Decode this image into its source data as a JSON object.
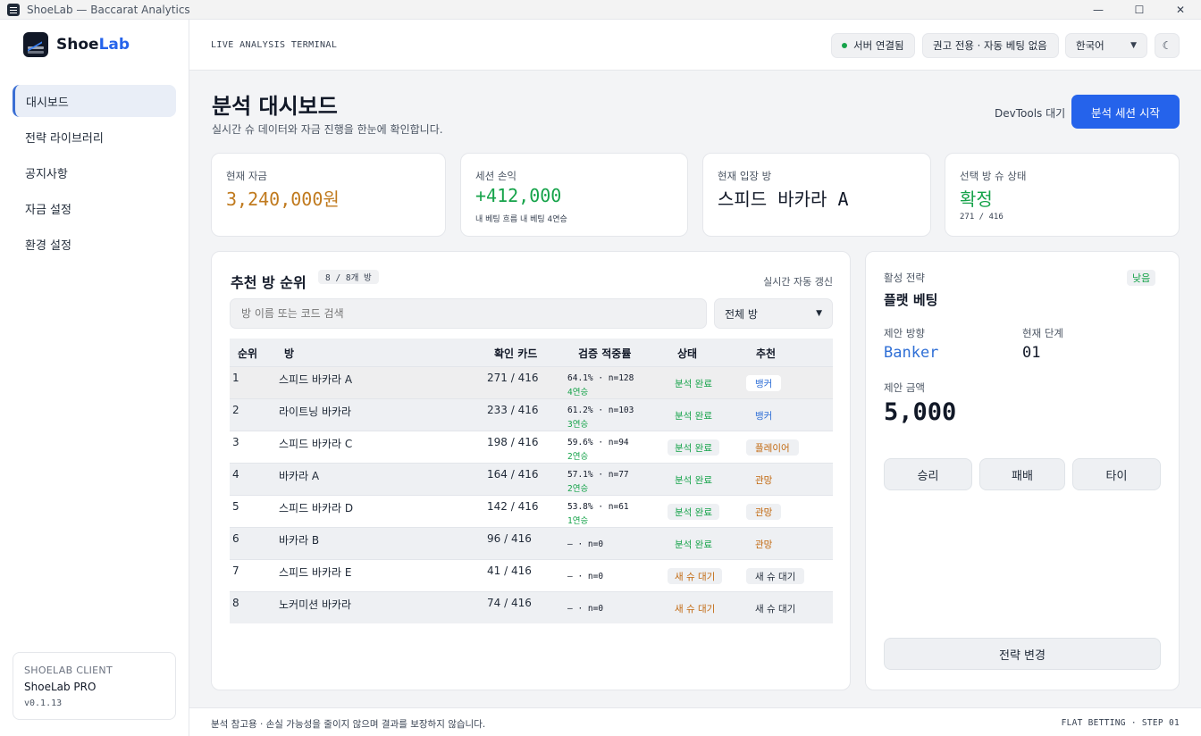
{
  "window": {
    "title": "ShoeLab — Baccarat Analytics",
    "controls": [
      "—",
      "☐",
      "✕"
    ]
  },
  "sidebar": {
    "logo": {
      "main": "Shoe",
      "accent": "Lab"
    },
    "items": [
      {
        "label": "대시보드",
        "active": true
      },
      {
        "label": "전략 라이브러리"
      },
      {
        "label": "공지사항"
      },
      {
        "label": "자금 설정"
      },
      {
        "label": "환경 설정"
      }
    ],
    "client": {
      "label": "SHOELAB CLIENT",
      "name": "ShoeLab PRO",
      "version": "v0.1.13"
    }
  },
  "topbar": {
    "terminal": "LIVE ANALYSIS TERMINAL",
    "server_status": "서버 연결됨",
    "mode": "권고 전용 · 자동 베팅 없음",
    "language": "한국어",
    "theme_icon": "☾"
  },
  "header": {
    "title": "분석 대시보드",
    "subtitle": "실시간 슈 데이터와 자금 진행을 한눈에 확인합니다.",
    "devtools": "DevTools 대기",
    "start_button": "분석 세션 시작"
  },
  "stats": [
    {
      "label": "현재 자금",
      "value": "3,240,000원",
      "color": "#c07a1e"
    },
    {
      "label": "세션 손익",
      "value": "+412,000",
      "sub": "내 베팅 흐름  내 베팅 4연승",
      "color": "#16a34a"
    },
    {
      "label": "현재 입장 방",
      "value": "스피드 바카라 A",
      "color": "#111827"
    },
    {
      "label": "선택 방 슈 상태",
      "value": "확정",
      "sub": "271 / 416",
      "color": "#16a34a"
    }
  ],
  "rooms": {
    "title": "추천 방 순위",
    "count": "8 / 8개 방",
    "live_note": "실시간 자동 갱신",
    "search_placeholder": "방 이름 또는 코드 검색",
    "filter": "전체 방",
    "columns": [
      "순위",
      "방",
      "확인 카드",
      "검증 적중률",
      "상태",
      "추천"
    ],
    "rows": [
      {
        "rank": "1",
        "room": "스피드 바카라 A",
        "cards": "271 / 416",
        "accuracy": "64.1% · n=128",
        "streak": "4연승",
        "status": "분석 완료",
        "rec": "뱅커"
      },
      {
        "rank": "2",
        "room": "라이트닝 바카라",
        "cards": "233 / 416",
        "accuracy": "61.2% · n=103",
        "streak": "3연승",
        "status": "분석 완료",
        "rec": "뱅커"
      },
      {
        "rank": "3",
        "room": "스피드 바카라 C",
        "cards": "198 / 416",
        "accuracy": "59.6% · n=94",
        "streak": "2연승",
        "status": "분석 완료",
        "rec": "플레이어"
      },
      {
        "rank": "4",
        "room": "바카라 A",
        "cards": "164 / 416",
        "accuracy": "57.1% · n=77",
        "streak": "2연승",
        "status": "분석 완료",
        "rec": "관망"
      },
      {
        "rank": "5",
        "room": "스피드 바카라 D",
        "cards": "142 / 416",
        "accuracy": "53.8% · n=61",
        "streak": "1연승",
        "status": "분석 완료",
        "rec": "관망"
      },
      {
        "rank": "6",
        "room": "바카라 B",
        "cards": "96 / 416",
        "accuracy": "— · n=0",
        "streak": "",
        "status": "분석 완료",
        "rec": "관망"
      },
      {
        "rank": "7",
        "room": "스피드 바카라 E",
        "cards": "41 / 416",
        "accuracy": "— · n=0",
        "streak": "",
        "status": "새 슈 대기",
        "rec": "새 슈 대기"
      },
      {
        "rank": "8",
        "room": "노커미션 바카라",
        "cards": "74 / 416",
        "accuracy": "— · n=0",
        "streak": "",
        "status": "새 슈 대기",
        "rec": "새 슈 대기"
      }
    ]
  },
  "strategy": {
    "label": "활성 전략",
    "name": "플랫 베팅",
    "level": "낮음",
    "direction_label": "제안 방향",
    "direction": "Banker",
    "step_label": "현재 단계",
    "step": "01",
    "amount_label": "제안 금액",
    "amount": "5,000",
    "buttons": [
      "승리",
      "패배",
      "타이"
    ],
    "change_button": "전략 변경"
  },
  "footer": {
    "disclaimer": "분석 참고용 · 손실 가능성을 줄이지 않으며 결과를 보장하지 않습니다.",
    "mode": "FLAT BETTING · STEP 01"
  },
  "colors": {
    "accent": "#2563eb",
    "green": "#16a34a",
    "orange": "#c2680f",
    "blue": "#2f6fd6",
    "amber": "#c07a1e"
  }
}
